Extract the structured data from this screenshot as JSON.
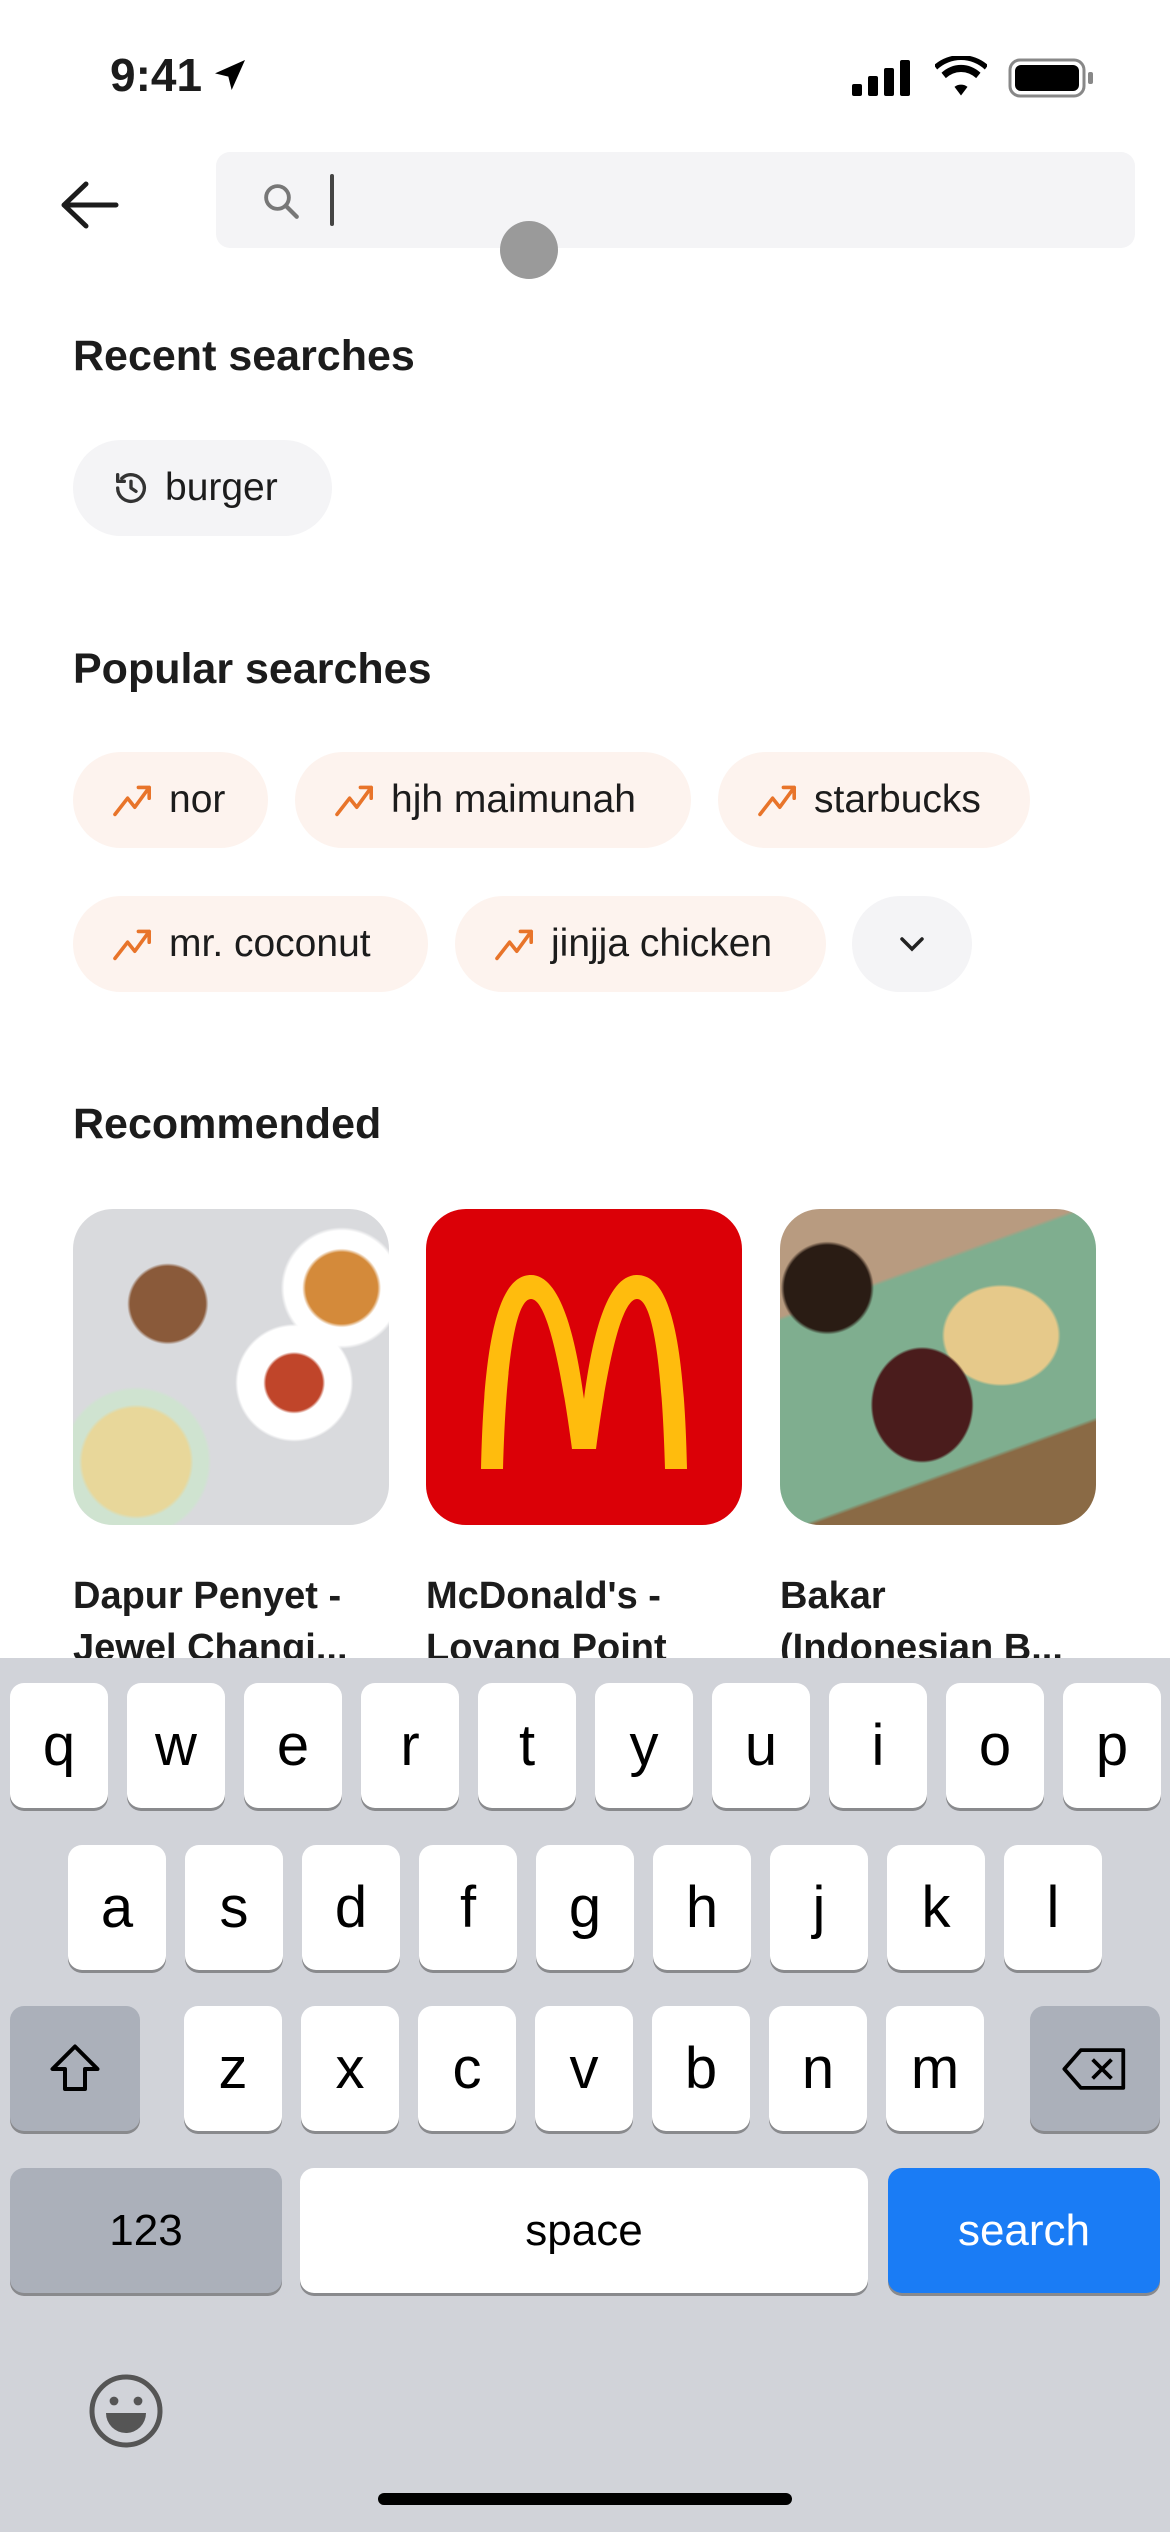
{
  "status_bar": {
    "time": "9:41"
  },
  "search": {
    "placeholder": ""
  },
  "recent": {
    "title": "Recent searches",
    "items": [
      "burger"
    ]
  },
  "popular": {
    "title": "Popular searches",
    "items": [
      "nor",
      "hjh maimunah",
      "starbucks",
      "mr. coconut",
      "jinjja chicken"
    ]
  },
  "recommended": {
    "title": "Recommended",
    "items": [
      {
        "line1": "Dapur Penyet -",
        "line2": "Jewel Changi..."
      },
      {
        "line1": "McDonald's -",
        "line2": "Loyang Point"
      },
      {
        "line1": "Bakar",
        "line2": "(Indonesian B..."
      }
    ]
  },
  "keyboard": {
    "row1": [
      "q",
      "w",
      "e",
      "r",
      "t",
      "y",
      "u",
      "i",
      "o",
      "p"
    ],
    "row2": [
      "a",
      "s",
      "d",
      "f",
      "g",
      "h",
      "j",
      "k",
      "l"
    ],
    "row3": [
      "z",
      "x",
      "c",
      "v",
      "b",
      "n",
      "m"
    ],
    "numbers": "123",
    "space": "space",
    "search": "search"
  },
  "colors": {
    "accent": "#e8742a",
    "search_key": "#1a7cf5",
    "mcdonalds_red": "#db0007",
    "mcdonalds_yellow": "#ffbc0d"
  }
}
